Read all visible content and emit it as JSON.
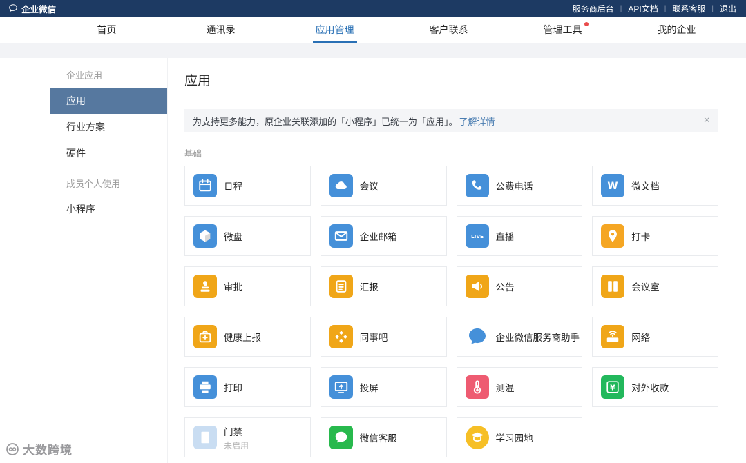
{
  "topbar": {
    "brand": "企业微信",
    "links": [
      {
        "id": "provider-console",
        "label": "服务商后台"
      },
      {
        "id": "api-docs",
        "label": "API文档"
      },
      {
        "id": "contact-support",
        "label": "联系客服"
      },
      {
        "id": "logout",
        "label": "退出"
      }
    ]
  },
  "nav": {
    "tabs": [
      {
        "id": "home",
        "label": "首页",
        "active": false,
        "badge": false
      },
      {
        "id": "contacts",
        "label": "通讯录",
        "active": false,
        "badge": false
      },
      {
        "id": "app-management",
        "label": "应用管理",
        "active": true,
        "badge": false
      },
      {
        "id": "customer-contact",
        "label": "客户联系",
        "active": false,
        "badge": false
      },
      {
        "id": "admin-tools",
        "label": "管理工具",
        "active": false,
        "badge": true
      },
      {
        "id": "my-company",
        "label": "我的企业",
        "active": false,
        "badge": false
      }
    ]
  },
  "sidebar": {
    "sections": [
      {
        "label": "企业应用",
        "items": [
          {
            "id": "apps",
            "label": "应用",
            "active": true
          },
          {
            "id": "industry-solutions",
            "label": "行业方案",
            "active": false
          },
          {
            "id": "hardware",
            "label": "硬件",
            "active": false
          }
        ]
      },
      {
        "label": "成员个人使用",
        "items": [
          {
            "id": "mini-programs",
            "label": "小程序",
            "active": false
          }
        ]
      }
    ]
  },
  "main": {
    "title": "应用",
    "notice": {
      "text": "为支持更多能力，原企业关联添加的「小程序」已统一为「应用」。",
      "link_label": "了解详情",
      "close_label": "×"
    },
    "group_label": "基础",
    "apps": [
      {
        "id": "schedule",
        "label": "日程",
        "icon": "calendar",
        "tile": "#4590d9"
      },
      {
        "id": "meeting",
        "label": "会议",
        "icon": "meeting",
        "tile": "#4590d9"
      },
      {
        "id": "free-call",
        "label": "公费电话",
        "icon": "phone",
        "tile": "#4590d9"
      },
      {
        "id": "wedoc",
        "label": "微文档",
        "icon": "wedoc",
        "tile": "#4590d9"
      },
      {
        "id": "wedrive",
        "label": "微盘",
        "icon": "drive",
        "tile": "#4590d9"
      },
      {
        "id": "corp-mail",
        "label": "企业邮箱",
        "icon": "mail",
        "tile": "#4590d9"
      },
      {
        "id": "live",
        "label": "直播",
        "icon": "live",
        "tile": "#4590d9"
      },
      {
        "id": "checkin",
        "label": "打卡",
        "icon": "pin",
        "tile": "#f5a623"
      },
      {
        "id": "approval",
        "label": "审批",
        "icon": "stamp",
        "tile": "#f0a618"
      },
      {
        "id": "report",
        "label": "汇报",
        "icon": "report",
        "tile": "#f0a618"
      },
      {
        "id": "announcement",
        "label": "公告",
        "icon": "megaphone",
        "tile": "#f0a618"
      },
      {
        "id": "meeting-room",
        "label": "会议室",
        "icon": "room",
        "tile": "#f0a618"
      },
      {
        "id": "health-report",
        "label": "健康上报",
        "icon": "health",
        "tile": "#f0a618"
      },
      {
        "id": "colleague-bar",
        "label": "同事吧",
        "icon": "diamonds",
        "tile": "#f0a618"
      },
      {
        "id": "provider-assistant",
        "label": "企业微信服务商助手",
        "icon": "wecom-bubble",
        "tile": "none",
        "glyph": "#4590d9"
      },
      {
        "id": "network",
        "label": "网络",
        "icon": "network",
        "tile": "#f0a618"
      },
      {
        "id": "print",
        "label": "打印",
        "icon": "printer",
        "tile": "#4590d9"
      },
      {
        "id": "screen-cast",
        "label": "投屏",
        "icon": "cast",
        "tile": "#4590d9"
      },
      {
        "id": "temperature",
        "label": "测温",
        "icon": "thermometer",
        "tile": "#ee5b71"
      },
      {
        "id": "external-payment",
        "label": "对外收款",
        "icon": "yuan",
        "tile": "#22b85c"
      },
      {
        "id": "door-access",
        "label": "门禁",
        "sub": "未启用",
        "icon": "door",
        "tile": "#c9ddf2"
      },
      {
        "id": "wechat-kf",
        "label": "微信客服",
        "icon": "kf-bubble",
        "tile": "#28b94d"
      },
      {
        "id": "study-garden",
        "label": "学习园地",
        "icon": "study",
        "tile": "#f6bf26",
        "round": true
      }
    ]
  },
  "watermark": {
    "label": "大数跨境"
  },
  "colors": {
    "topbar_bg": "#1d3a63",
    "nav_active": "#2970b5",
    "sidebar_active_bg": "#56789f",
    "link": "#4a7db1",
    "badge_red": "#e94b4b"
  }
}
